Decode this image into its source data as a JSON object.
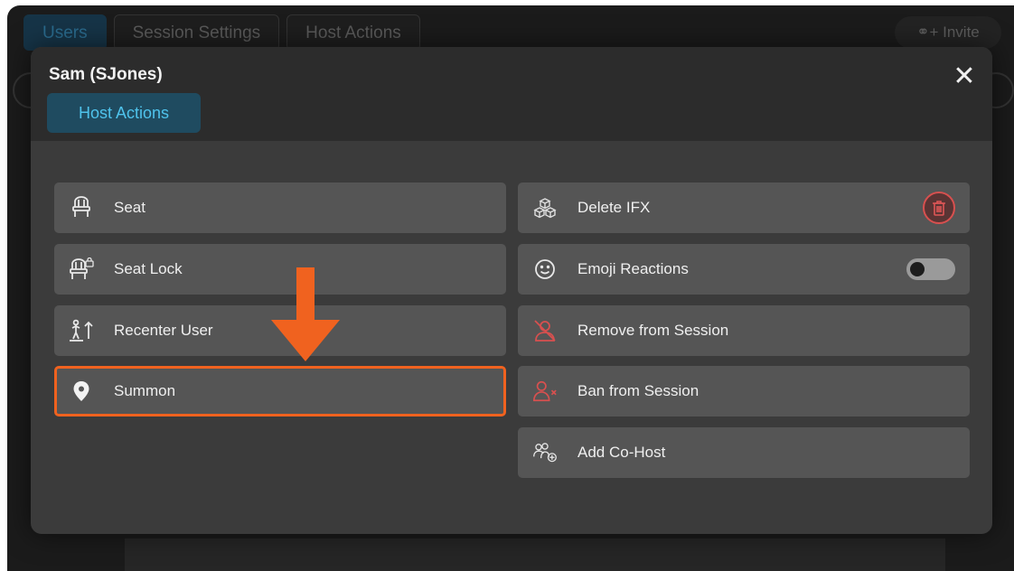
{
  "background": {
    "tabs": [
      "Users",
      "Session Settings",
      "Host Actions"
    ],
    "invite_label": "Invite"
  },
  "modal": {
    "title": "Sam (SJones)",
    "close_symbol": "✕",
    "tab": "Host Actions",
    "left_actions": [
      {
        "label": "Seat",
        "icon": "chair-icon"
      },
      {
        "label": "Seat Lock",
        "icon": "chair-lock-icon"
      },
      {
        "label": "Recenter User",
        "icon": "recenter-user-icon"
      },
      {
        "label": "Summon",
        "icon": "location-pin-icon",
        "highlighted": true
      }
    ],
    "right_actions": [
      {
        "label": "Delete IFX",
        "icon": "cubes-icon",
        "control": "trash-icon"
      },
      {
        "label": "Emoji Reactions",
        "icon": "smiley-icon",
        "control": "toggle",
        "toggle_on": false
      },
      {
        "label": "Remove from Session",
        "icon": "user-removed-icon"
      },
      {
        "label": "Ban from Session",
        "icon": "user-ban-icon"
      },
      {
        "label": "Add Co-Host",
        "icon": "add-cohost-icon"
      }
    ]
  },
  "colors": {
    "accent": "#4fc3ec",
    "highlight": "#f0621f",
    "danger": "#d8504f",
    "button_bg": "#555555",
    "modal_bg": "#3b3b3b"
  }
}
